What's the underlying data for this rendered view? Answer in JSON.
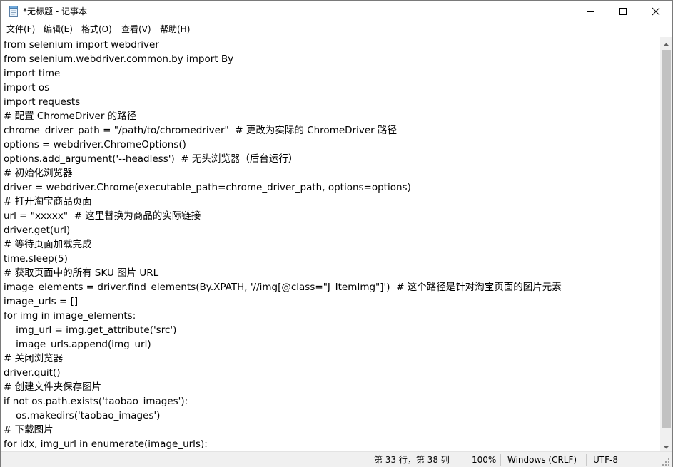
{
  "window": {
    "title": "*无标题 - 记事本",
    "icon": "notepad-icon",
    "controls": {
      "minimize": "minimize-icon",
      "maximize": "maximize-icon",
      "close": "close-icon"
    }
  },
  "menu": [
    "文件(F)",
    "编辑(E)",
    "格式(O)",
    "查看(V)",
    "帮助(H)"
  ],
  "editor": {
    "lines": [
      "from selenium import webdriver",
      "from selenium.webdriver.common.by import By",
      "import time",
      "import os",
      "import requests",
      "# 配置 ChromeDriver 的路径",
      "chrome_driver_path = \"/path/to/chromedriver\"  # 更改为实际的 ChromeDriver 路径",
      "options = webdriver.ChromeOptions()",
      "options.add_argument('--headless')  # 无头浏览器（后台运行）",
      "# 初始化浏览器",
      "driver = webdriver.Chrome(executable_path=chrome_driver_path, options=options)",
      "# 打开淘宝商品页面",
      "url = \"xxxxx\"  # 这里替换为商品的实际链接",
      "driver.get(url)",
      "# 等待页面加载完成",
      "time.sleep(5)",
      "# 获取页面中的所有 SKU 图片 URL",
      "image_elements = driver.find_elements(By.XPATH, '//img[@class=\"J_ItemImg\"]')  # 这个路径是针对淘宝页面的图片元素",
      "image_urls = []",
      "for img in image_elements:",
      "    img_url = img.get_attribute('src')",
      "    image_urls.append(img_url)",
      "# 关闭浏览器",
      "driver.quit()",
      "# 创建文件夹保存图片",
      "if not os.path.exists('taobao_images'):",
      "    os.makedirs('taobao_images')",
      "# 下载图片",
      "for idx, img_url in enumerate(image_urls):"
    ]
  },
  "status": {
    "position": "第 33 行，第 38 列",
    "zoom": "100%",
    "line_ending": "Windows (CRLF)",
    "encoding": "UTF-8"
  }
}
